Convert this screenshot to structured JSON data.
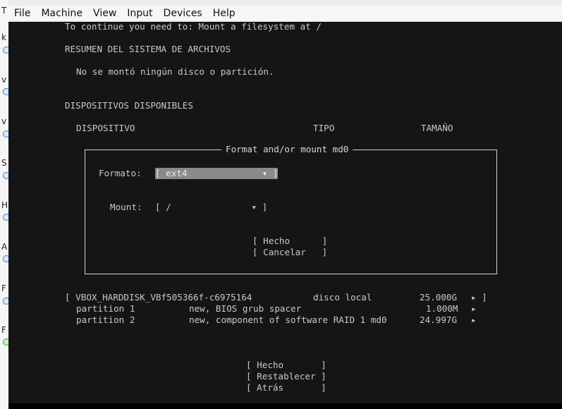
{
  "host_strip": {
    "letters": [
      "T",
      "k",
      "v",
      "v",
      "S",
      "H",
      "A",
      "F",
      "F"
    ]
  },
  "menubar": {
    "items": [
      "File",
      "Machine",
      "View",
      "Input",
      "Devices",
      "Help"
    ]
  },
  "console": {
    "continue_msg": "To continue you need to: Mount a filesystem at /",
    "summary_heading": "RESUMEN DEL SISTEMA DE ARCHIVOS",
    "summary_empty": "No se montó ningún disco o partición.",
    "devices_heading": "DISPOSITIVOS DISPONIBLES",
    "columns": {
      "device": "DISPOSITIVO",
      "type": "TIPO",
      "size": "TAMAÑO"
    }
  },
  "dialog": {
    "title": "Format and/or mount md0",
    "format_label": "Formato:",
    "format_value": "[ ext4              ▾ ]",
    "mount_label": "Mount:",
    "mount_value": "[ /               ▾ ]",
    "done_button": "[ Hecho      ]",
    "cancel_button": "[ Cancelar   ]"
  },
  "devices": [
    {
      "name": "[ VBOX_HARDDISK_VBf505366f-c6975164",
      "type": "disco local",
      "size": "25.000G",
      "arrow": "▸ ]"
    },
    {
      "name": "partition 1",
      "type": "new, BIOS grub spacer",
      "size": "1.000M",
      "arrow": "▸"
    },
    {
      "name": "partition 2",
      "type": "new, component of software RAID 1 md0",
      "size": "24.997G",
      "arrow": "▸"
    }
  ],
  "footer": {
    "done": "[ Hecho       ]",
    "reset": "[ Restablecer ]",
    "back": "[ Atrás       ]"
  },
  "colors": {
    "terminal_bg": "#151515",
    "terminal_fg": "#c9c9c9",
    "highlight_bg": "#8a8a8a"
  }
}
